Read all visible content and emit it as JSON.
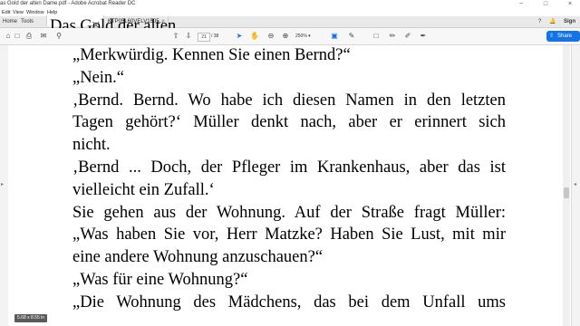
{
  "window": {
    "title": "as Gold der alten Dame.pdf - Adobe Acrobat Reader DC",
    "controls": [
      "−",
      "□",
      "×"
    ]
  },
  "menu": [
    "Edit",
    "View",
    "Window",
    "Help"
  ],
  "tabs": {
    "home": "Home",
    "tools": "Tools",
    "doc1": "Das Gold der alten ...",
    "doc2": "KTP05L60VELV1505...",
    "close": "×",
    "sign_in": "Sign In"
  },
  "toolbar": {
    "page_current": "21",
    "page_total": "/ 38",
    "zoom": "250%",
    "share": "Share"
  },
  "document": {
    "lines": [
      "„Merkwürdig. Kennen Sie einen Bernd?“",
      "„Nein.“",
      "‚Bernd. Bernd. Wo habe ich diesen Namen in den letzten",
      "Tagen gehört?‘ Müller denkt nach, aber er erinnert sich",
      "nicht.",
      "‚Bernd ... Doch, der Pfleger im Krankenhaus, aber das ist",
      "vielleicht ein Zufall.‘",
      "Sie gehen aus der Wohnung. Auf der Straße fragt Müller:",
      "„Was haben Sie vor, Herr Matzke? Haben Sie Lust, mit mir",
      "eine andere Wohnung anzuschauen?“",
      "„Was für eine Wohnung?“",
      "„Die Wohnung des Mädchens, das bei dem Unfall ums"
    ]
  },
  "status": {
    "page_size": "5.68 x 8.55 in"
  }
}
